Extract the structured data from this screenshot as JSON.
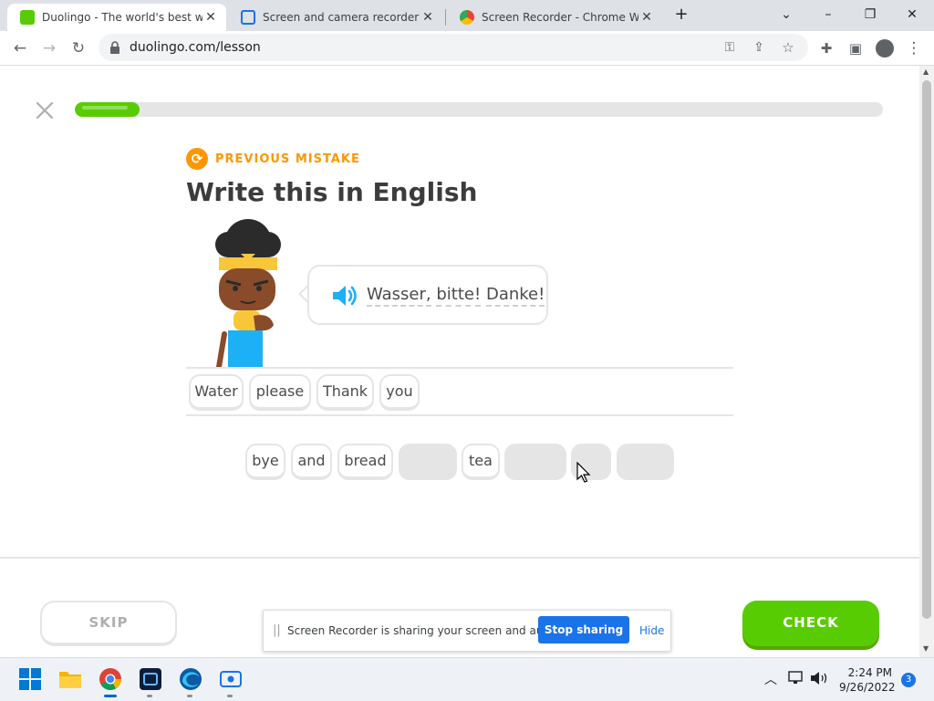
{
  "browser": {
    "tabs": [
      {
        "title": "Duolingo - The world's best way",
        "active": true
      },
      {
        "title": "Screen and camera recorder - Sc",
        "active": false
      },
      {
        "title": "Screen Recorder - Chrome Web",
        "active": false
      }
    ],
    "new_tab_label": "+",
    "url": "duolingo.com/lesson",
    "window_controls": {
      "dropdown": "⌄",
      "minimize": "–",
      "restore": "❐",
      "close": "✕"
    }
  },
  "lesson": {
    "progress_percent": 8,
    "badge_label": "PREVIOUS MISTAKE",
    "heading": "Write this in English",
    "phrase_words": [
      "Wasser,",
      "bitte!",
      "Danke!"
    ],
    "answer_words": [
      "Water",
      "please",
      "Thank",
      "you"
    ],
    "word_bank": [
      {
        "label": "bye",
        "used": false
      },
      {
        "label": "and",
        "used": false
      },
      {
        "label": "bread",
        "used": false
      },
      {
        "label": "",
        "used": true
      },
      {
        "label": "tea",
        "used": false
      },
      {
        "label": "",
        "used": true
      },
      {
        "label": "",
        "used": true
      },
      {
        "label": "",
        "used": true
      }
    ],
    "skip_label": "SKIP",
    "check_label": "CHECK"
  },
  "share_bar": {
    "grip": "||",
    "message": "Screen Recorder is sharing your screen and audio.",
    "stop_label": "Stop sharing",
    "hide_label": "Hide"
  },
  "taskbar": {
    "time": "2:24 PM",
    "date": "9/26/2022",
    "notification_count": "3"
  },
  "colors": {
    "brand_green": "#58cc02",
    "accent_orange": "#ff9600",
    "share_blue": "#1a73e8"
  }
}
